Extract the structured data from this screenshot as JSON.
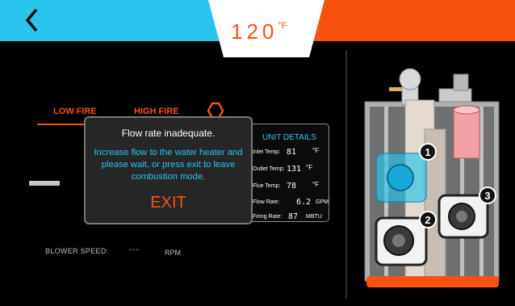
{
  "header": {
    "temperature": "120",
    "temperature_unit": "°F",
    "left_color": "#29c5ef",
    "right_color": "#f7530f",
    "back_icon": "chevron-left-icon"
  },
  "tabs": {
    "low_fire": "LOW FIRE",
    "high_fire": "HIGH FIRE",
    "alert_icon": "warning-icon"
  },
  "dialog": {
    "title": "Flow rate inadequate.",
    "message": "Increase flow to the water heater and please wait, or press exit to leave combustion mode.",
    "exit_label": "EXIT"
  },
  "unit_details": {
    "title": "UNIT DETAILS",
    "rows": [
      {
        "label": "Inlet Temp:",
        "value": "81",
        "unit": "°F"
      },
      {
        "label": "Outlet Temp:",
        "value": "131",
        "unit": "°F"
      },
      {
        "label": "Flue Temp:",
        "value": "78",
        "unit": "°F"
      },
      {
        "label": "Flow Rate:",
        "value": "6.2",
        "unit": "GPM"
      },
      {
        "label": "Firing Rate:",
        "value": "87",
        "unit": "MBTU"
      }
    ]
  },
  "blower": {
    "label": "BLOWER SPEED:",
    "value": "---",
    "unit": "RPM"
  },
  "heater_callouts": [
    "1",
    "2",
    "3"
  ],
  "colors": {
    "accent_blue": "#29c5ef",
    "accent_orange": "#f7530f"
  }
}
